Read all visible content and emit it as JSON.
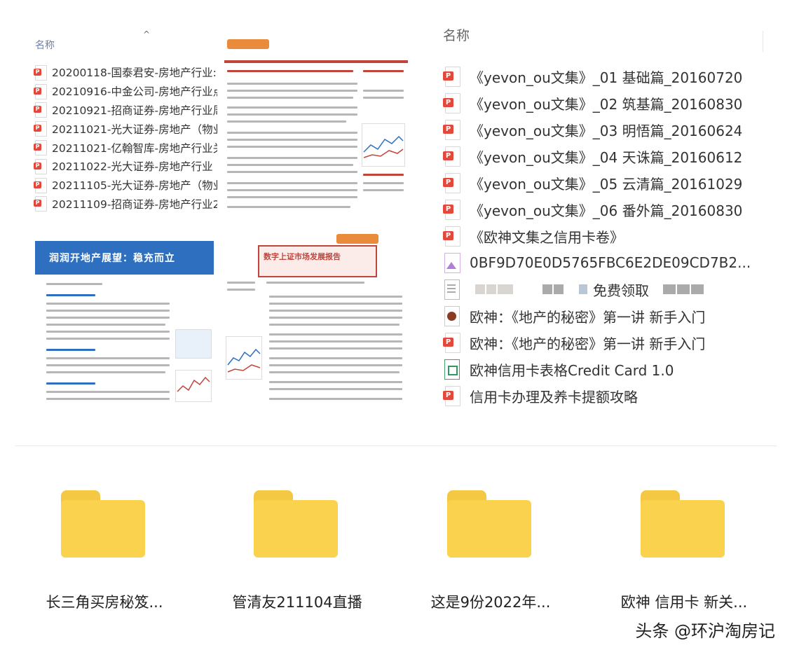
{
  "left_panel": {
    "column_header": "名称",
    "sort_arrow": "^",
    "files": [
      "20200118-国泰君安-房地产行业:",
      "20210916-中金公司-房地产行业点",
      "20210921-招商证券-房地产行业周",
      "20211021-光大证券-房地产（物业",
      "20211021-亿翰智库-房地产行业关",
      "20211022-光大证券-房地产行业（",
      "20211105-光大证券-房地产（物业",
      "20211109-招商证券-房地产行业20"
    ]
  },
  "thumbnails": {
    "b_banner": "润润开地产展望：稳充而立",
    "c_title": "数字上证市场发展报告"
  },
  "right_panel": {
    "column_header": "名称",
    "files": [
      {
        "name": "《yevon_ou文集》_01 基础篇_20160720",
        "icon": "pdf-icon"
      },
      {
        "name": "《yevon_ou文集》_02 筑基篇_20160830",
        "icon": "pdf-icon"
      },
      {
        "name": "《yevon_ou文集》_03 明悟篇_20160624",
        "icon": "pdf-icon"
      },
      {
        "name": "《yevon_ou文集》_04 天诛篇_20160612",
        "icon": "pdf-icon"
      },
      {
        "name": "《yevon_ou文集》_05 云清篇_20161029",
        "icon": "pdf-icon"
      },
      {
        "name": "《yevon_ou文集》_06 番外篇_20160830",
        "icon": "pdf-icon"
      },
      {
        "name": "《欧神文集之信用卡卷》",
        "icon": "pdf-icon"
      },
      {
        "name": "0BF9D70E0D5765FBC6E2DE09CD7B2...",
        "icon": "image-icon"
      },
      {
        "name": "免费领取",
        "icon": "document-icon"
      },
      {
        "name": "欧神：《地产的秘密》第一讲 新手入门",
        "icon": "audio-icon"
      },
      {
        "name": "欧神：《地产的秘密》第一讲 新手入门",
        "icon": "pdf-icon"
      },
      {
        "name": "欧神信用卡表格Credit Card 1.0",
        "icon": "spreadsheet-icon"
      },
      {
        "name": "信用卡办理及养卡提额攻略",
        "icon": "pdf-icon"
      }
    ]
  },
  "folders": [
    "长三角买房秘笈...",
    "管清友211104直播",
    "这是9份2022年...",
    "欧神 信用卡 新关..."
  ],
  "watermark": "头条 @环沪淘房记",
  "colors": {
    "pdf_red": "#e5483a",
    "folder_yellow": "#fbd24e",
    "banner_blue": "#2f6fbf"
  }
}
